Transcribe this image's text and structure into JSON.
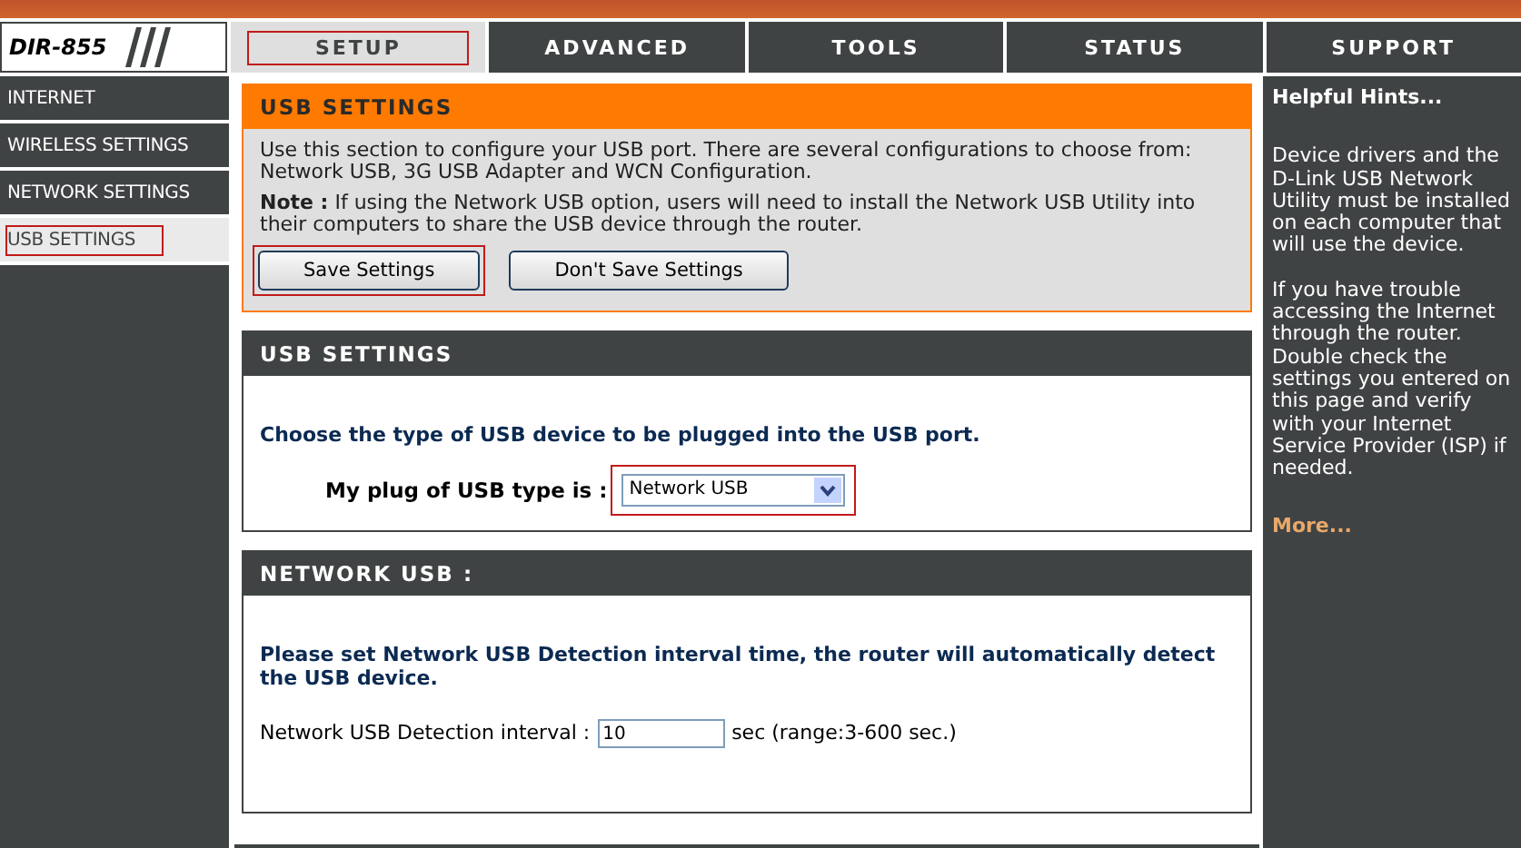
{
  "logo": {
    "model": "DIR-855"
  },
  "tabs": [
    {
      "label": "SETUP",
      "selected": true,
      "highlighted": true
    },
    {
      "label": "ADVANCED",
      "selected": false,
      "highlighted": false
    },
    {
      "label": "TOOLS",
      "selected": false,
      "highlighted": false
    },
    {
      "label": "STATUS",
      "selected": false,
      "highlighted": false
    },
    {
      "label": "SUPPORT",
      "selected": false,
      "highlighted": false
    }
  ],
  "sidebar": {
    "items": [
      {
        "label": "INTERNET",
        "selected": false,
        "highlighted": false
      },
      {
        "label": "WIRELESS SETTINGS",
        "selected": false,
        "highlighted": false
      },
      {
        "label": "NETWORK SETTINGS",
        "selected": false,
        "highlighted": false
      },
      {
        "label": "USB SETTINGS",
        "selected": true,
        "highlighted": true
      }
    ]
  },
  "intro": {
    "title": "USB SETTINGS",
    "description": "Use this section to configure your USB port. There are several configurations to choose from: Network USB, 3G USB Adapter and WCN Configuration.",
    "note": "**Note :** If using the Network USB option, users will need to install the Network USB Utility into their computers to share the USB device through the router.",
    "buttons": [
      {
        "label": "Save Settings",
        "highlighted": true
      },
      {
        "label": "Don't Save Settings",
        "highlighted": false
      }
    ]
  },
  "usb_settings": {
    "title": "USB SETTINGS",
    "instruction": "Choose the type of USB device to be plugged into the USB port.",
    "type_label": "My plug of USB type is :",
    "type_select": {
      "value": "Network USB",
      "highlighted": true
    }
  },
  "network_usb": {
    "title": "NETWORK USB :",
    "instruction": "Please set Network USB Detection interval time, the router will automatically detect the USB device.",
    "interval_label": "Network USB Detection interval :",
    "interval_value": "10",
    "interval_hint": "sec (range:3-600 sec.)"
  },
  "hints": {
    "title": "Helpful Hints...",
    "paragraphs": [
      "Device drivers and the D-Link USB Network Utility must be installed on each computer that will use the device.",
      "If you have trouble accessing the Internet through the router. Double check the settings you entered on this page and verify with your Internet Service Provider (ISP) if needed."
    ],
    "more_link": "More..."
  }
}
